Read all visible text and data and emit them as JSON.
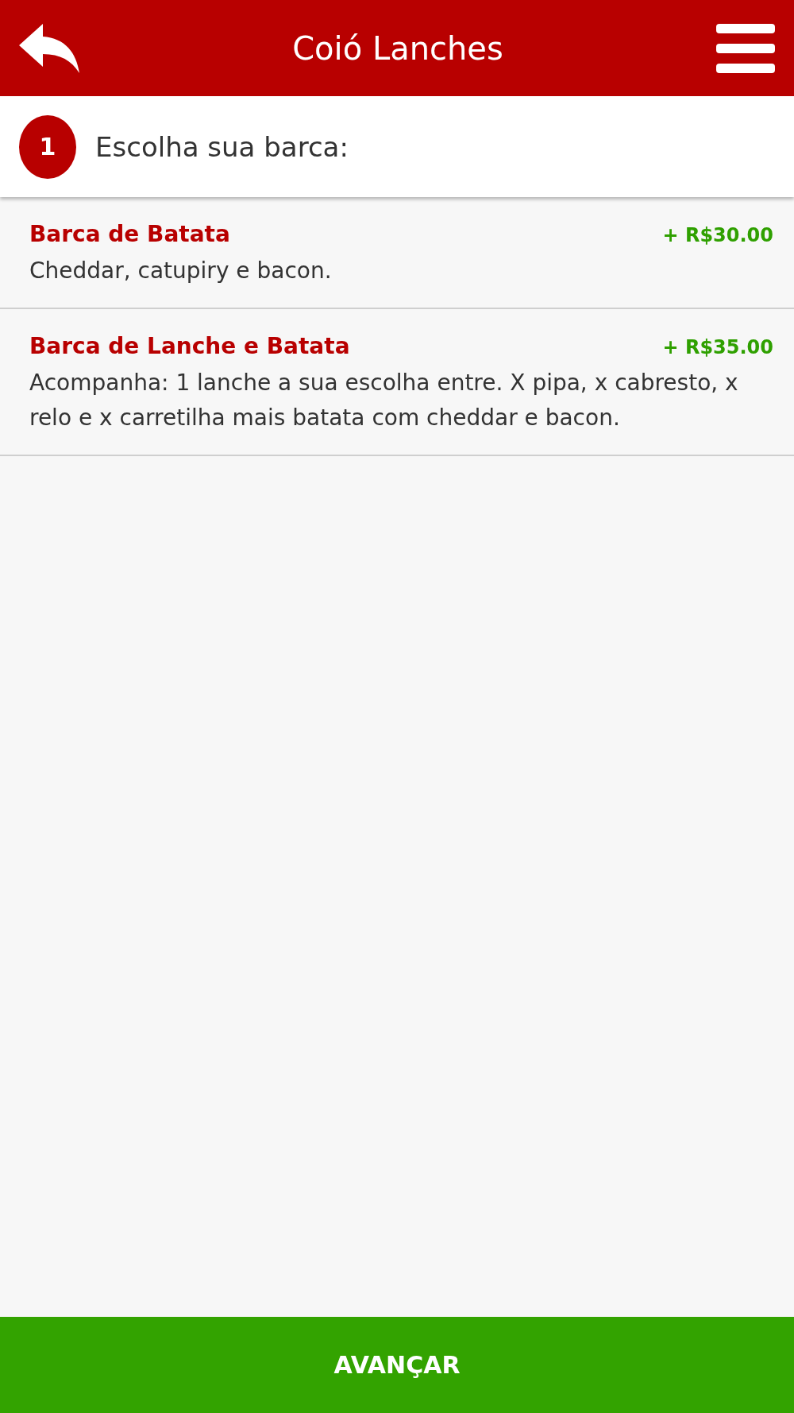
{
  "header": {
    "title": "Coió Lanches"
  },
  "step": {
    "number": "1",
    "label": "Escolha sua barca:"
  },
  "options": [
    {
      "name": "Barca de Batata",
      "price": "+ R$30.00",
      "description": "Cheddar, catupiry e bacon."
    },
    {
      "name": "Barca de Lanche e Batata",
      "price": "+ R$35.00",
      "description": "Acompanha: 1 lanche a sua escolha entre. X pipa, x cabresto, x relo e x carretilha mais batata com cheddar e bacon."
    }
  ],
  "footer": {
    "button": "AVANÇAR"
  }
}
